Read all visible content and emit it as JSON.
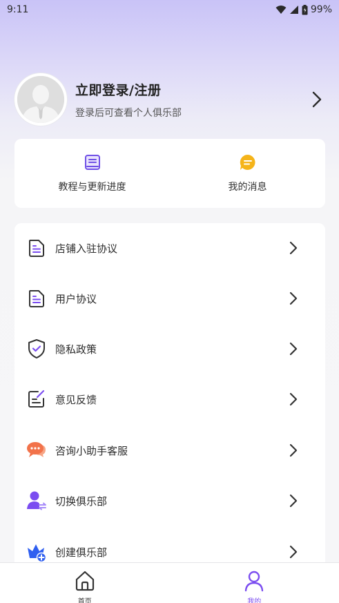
{
  "status_bar": {
    "time": "9:11",
    "battery": "99%",
    "icons": [
      "wifi-icon",
      "signal-icon",
      "battery-icon"
    ]
  },
  "profile": {
    "title": "立即登录/注册",
    "subtitle": "登录后可查看个人俱乐部"
  },
  "quick_actions": [
    {
      "label": "教程与更新进度",
      "icon": "book-icon"
    },
    {
      "label": "我的消息",
      "icon": "message-icon"
    }
  ],
  "menu": [
    {
      "label": "店铺入驻协议",
      "icon": "document-icon"
    },
    {
      "label": "用户协议",
      "icon": "document-icon"
    },
    {
      "label": "隐私政策",
      "icon": "shield-check-icon"
    },
    {
      "label": "意见反馈",
      "icon": "edit-note-icon"
    },
    {
      "label": "咨询小助手客服",
      "icon": "chat-bubble-icon"
    },
    {
      "label": "切换俱乐部",
      "icon": "user-switch-icon"
    },
    {
      "label": "创建俱乐部",
      "icon": "crown-add-icon"
    }
  ],
  "tabs": [
    {
      "label": "首页",
      "icon": "home-icon"
    },
    {
      "label": "我的",
      "icon": "person-icon"
    }
  ],
  "colors": {
    "accent": "#7b4df0",
    "message_yellow": "#f5b41a",
    "chat_orange": "#f2724a"
  }
}
